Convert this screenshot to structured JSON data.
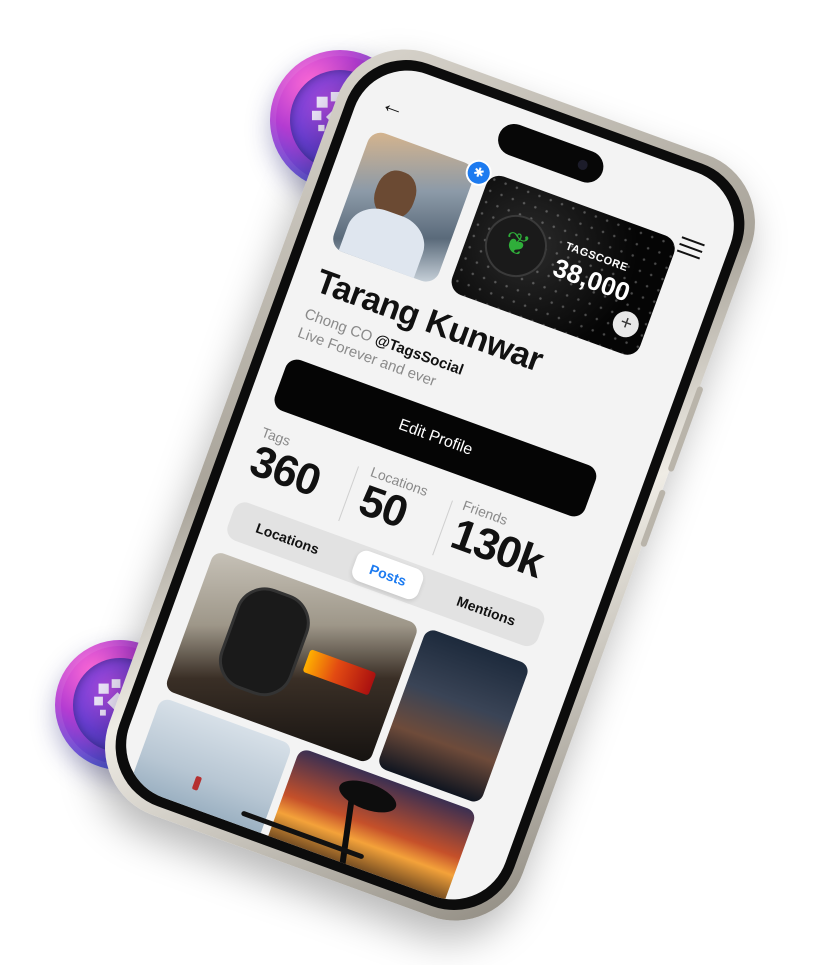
{
  "profile": {
    "name": "Tarang Kunwar",
    "bio_prefix": "Chong CO",
    "handle": "@TagsSocial",
    "bio_line2": "Live Forever and ever",
    "verified_icon": "verified-badge-icon"
  },
  "score_card": {
    "label": "TAGSCORE",
    "value": "38,000",
    "add_symbol": "+"
  },
  "actions": {
    "edit_profile": "Edit Profile"
  },
  "stats": [
    {
      "label": "Tags",
      "value": "360"
    },
    {
      "label": "Locations",
      "value": "50"
    },
    {
      "label": "Friends",
      "value": "130k"
    }
  ],
  "tabs": [
    {
      "label": "Locations",
      "active": false
    },
    {
      "label": "Posts",
      "active": true
    },
    {
      "label": "Mentions",
      "active": false
    }
  ],
  "nav": {
    "back_symbol": "←",
    "back_icon": "back-arrow-icon",
    "menu_icon": "hamburger-menu-icon"
  },
  "colors": {
    "accent": "#1d7bf0",
    "button": "#050505",
    "coin_pink": "#ff6ad5",
    "coin_blue": "#3d4fd8"
  }
}
